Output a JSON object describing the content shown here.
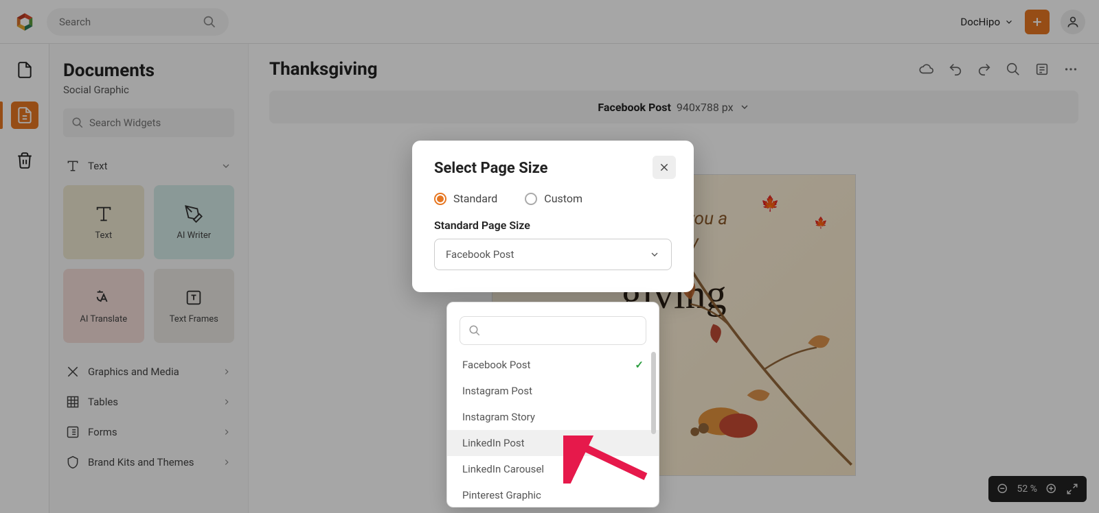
{
  "topbar": {
    "search_placeholder": "Search",
    "workspace": "DocHipo"
  },
  "side_panel": {
    "title": "Documents",
    "subtitle": "Social Graphic",
    "widget_search_placeholder": "Search Widgets",
    "text_section": "Text",
    "widgets": [
      {
        "label": "Text",
        "tone": "beige"
      },
      {
        "label": "AI Writer",
        "tone": "teal"
      },
      {
        "label": "AI Translate",
        "tone": "pink"
      },
      {
        "label": "Text Frames",
        "tone": "gray"
      }
    ],
    "sections": [
      "Graphics and Media",
      "Tables",
      "Forms",
      "Brand Kits and Themes"
    ]
  },
  "main": {
    "title": "Thanksgiving",
    "size_label": "Facebook Post",
    "size_dims": "940x788 px",
    "greeting_line1": "Wishing you a",
    "greeting_line2": "Happy",
    "script_word": "giving"
  },
  "modal": {
    "title": "Select Page Size",
    "radio_standard": "Standard",
    "radio_custom": "Custom",
    "field_label": "Standard Page Size",
    "selected_value": "Facebook Post"
  },
  "dropdown": {
    "items": [
      {
        "label": "Facebook Post",
        "selected": true
      },
      {
        "label": "Instagram Post"
      },
      {
        "label": "Instagram Story"
      },
      {
        "label": "LinkedIn Post",
        "hover": true
      },
      {
        "label": "LinkedIn Carousel"
      },
      {
        "label": "Pinterest Graphic"
      }
    ]
  },
  "zoom": {
    "value": "52 %"
  }
}
